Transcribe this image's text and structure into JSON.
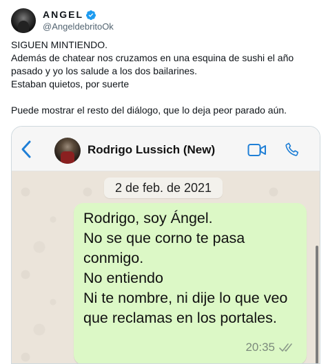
{
  "tweet": {
    "display_name": "ANGEL",
    "handle": "@AngeldebritoOk",
    "verified_color": "#1d9bf0",
    "text_lines": [
      "SIGUEN MINTIENDO.",
      "Además de chatear nos cruzamos en una esquina de sushi el año pasado y yo los salude a los dos bailarines.",
      "Estaban quietos, por suerte",
      "",
      "Puede mostrar el resto del diálogo, que lo deja peor parado aún."
    ]
  },
  "whatsapp": {
    "contact_name": "Rodrigo Lussich (New)",
    "accent_color": "#1f7fd6",
    "date_label": "2 de feb. de 2021",
    "message": {
      "lines": [
        "Rodrigo, soy Ángel.",
        "No se que corno te pasa",
        "conmigo.",
        "No entiendo",
        "Ni te nombre, ni dije lo que veo",
        "que reclamas en los portales."
      ],
      "time": "20:35",
      "status_icon": "double-check-icon",
      "bubble_color": "#dcf8c6"
    }
  }
}
